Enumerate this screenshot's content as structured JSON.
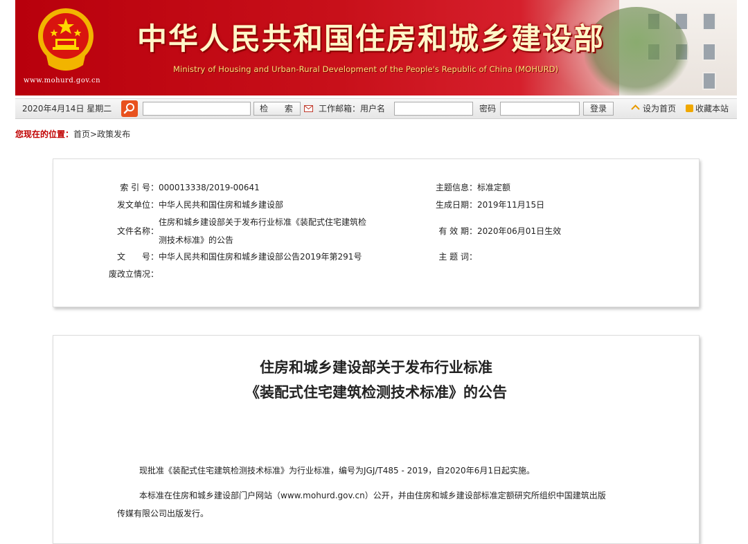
{
  "banner": {
    "site_url": "www.mohurd.gov.cn",
    "title_cn": "中华人民共和国住房和城乡建设部",
    "title_en": "Ministry of Housing and Urban-Rural Development of the People's Republic of China (MOHURD)"
  },
  "toolbar": {
    "date": "2020年4月14日 星期二",
    "search_placeholder": "",
    "search_button": "检 索",
    "mailbox_label": "工作邮箱：用户名",
    "username_value": "",
    "password_label": "密码",
    "password_value": "",
    "login_button": "登录",
    "set_home": "设为首页",
    "bookmark": "收藏本站"
  },
  "breadcrumb": {
    "lead": "您现在的位置：",
    "path": "首页>政策发布"
  },
  "info": {
    "index_label": "索 引 号：",
    "index_value": "000013338/2019-00641",
    "issuer_label": "发文单位：",
    "issuer_value": "中华人民共和国住房和城乡建设部",
    "filename_label": "文件名称：",
    "filename_line1": "住房和城乡建设部关于发布行业标准《装配式住宅建筑检",
    "filename_line2": "测技术标准》的公告",
    "docno_label": "文　　号：",
    "docno_value": "中华人民共和国住房和城乡建设部公告2019年第291号",
    "repeal_label": "废改立情况：",
    "repeal_value": "",
    "topic_label": "主题信息：",
    "topic_value": "标准定额",
    "created_label": "生成日期：",
    "created_value": "2019年11月15日",
    "valid_label": "有 效 期：",
    "valid_value": "2020年06月01日生效",
    "keyword_label": "主 题 词：",
    "keyword_value": ""
  },
  "document": {
    "title_line1": "住房和城乡建设部关于发布行业标准",
    "title_line2": "《装配式住宅建筑检测技术标准》的公告",
    "para1": "现批准《装配式住宅建筑检测技术标准》为行业标准，编号为JGJ/T485 - 2019，自2020年6月1日起实施。",
    "para2_line1": "本标准在住房和城乡建设部门户网站（www.mohurd.gov.cn）公开，并由住房和城乡建设部标准定额研究所组织中国建筑出版",
    "para2_line2": "传媒有限公司出版发行。"
  },
  "colors": {
    "banner_red": "#c8101a",
    "breadcrumb_red": "#c00000",
    "search_orange": "#e8521f"
  }
}
